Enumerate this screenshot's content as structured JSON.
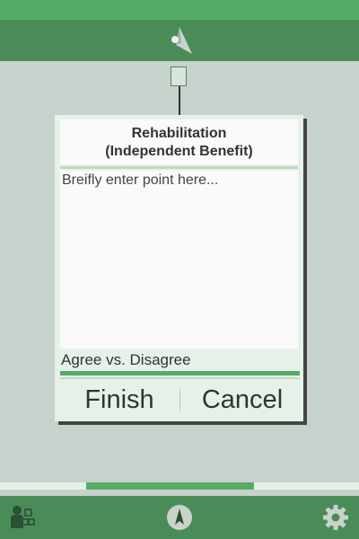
{
  "dialog": {
    "title_line1": "Rehabilitation",
    "title_line2": "(Independent Benefit)",
    "point_placeholder": "Breifly enter point here...",
    "agree_label": "Agree vs. Disagree",
    "finish_label": "Finish",
    "cancel_label": "Cancel"
  },
  "icons": {
    "top": "app-logo-icon",
    "bottom_left": "people-icon",
    "bottom_center": "compass-icon",
    "bottom_right": "gear-icon"
  },
  "colors": {
    "accent": "#56ac66",
    "bar": "#4a8c57",
    "background": "#c8d2cc"
  }
}
